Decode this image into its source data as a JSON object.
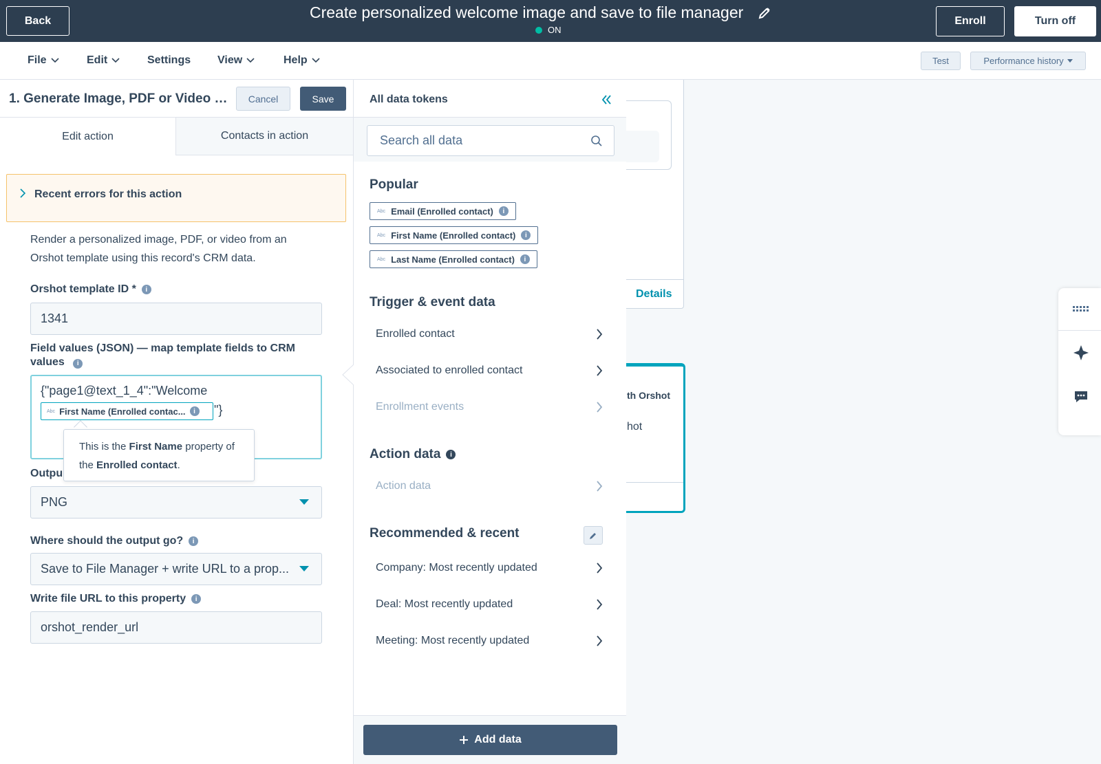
{
  "topbar": {
    "back_label": "Back",
    "title": "Create personalized welcome image and save to file manager",
    "status": "ON",
    "status_color": "#00bda5",
    "enroll_label": "Enroll",
    "turnoff_label": "Turn off"
  },
  "menubar": {
    "file": "File",
    "edit": "Edit",
    "settings": "Settings",
    "view": "View",
    "help": "Help",
    "test": "Test",
    "performance": "Performance history"
  },
  "panel": {
    "title": "1. Generate Image, PDF or Video wi...",
    "cancel": "Cancel",
    "save": "Save",
    "tab_edit": "Edit action",
    "tab_contacts": "Contacts in action",
    "errors": "Recent errors for this action",
    "description": "Render a personalized image, PDF, or video from an Orshot template using this record's CRM data.",
    "template_label": "Orshot template ID *",
    "template_value": "1341",
    "fields_label": "Field values (JSON) — map template fields to CRM values",
    "json_prefix": "{\"page1@text_1_4\":\"Welcome",
    "token_label": "First Name (Enrolled contac...",
    "json_suffix": "\"}",
    "tooltip_p1": "This is the ",
    "tooltip_b1": "First Name",
    "tooltip_p2": " property of the ",
    "tooltip_b2": "Enrolled contact",
    "tooltip_p3": ".",
    "output_label": "Outpu",
    "output_value": "PNG",
    "destination_label": "Where should the output go?",
    "destination_value": "Save to File Manager + write URL to a prop...",
    "url_label": "Write file URL to this property",
    "url_value": "orshot_render_url"
  },
  "tokens": {
    "title": "All data tokens",
    "search_placeholder": "Search all data",
    "popular_title": "Popular",
    "popular": [
      "Email (Enrolled contact)",
      "First Name (Enrolled contact)",
      "Last Name (Enrolled contact)"
    ],
    "abc": "Abc",
    "trigger_title": "Trigger & event data",
    "trigger_items": [
      "Enrolled contact",
      "Associated to enrolled contact",
      "Enrollment events"
    ],
    "action_title": "Action data",
    "action_items": [
      "Action data"
    ],
    "recommended_title": "Recommended & recent",
    "recommended_items": [
      "Company: Most recently updated",
      "Deal: Most recently updated",
      "Meeting: Most recently updated"
    ],
    "add_data": "Add data"
  },
  "canvas": {
    "details": "Details",
    "card2_title": "th Orshot",
    "card2_text": "hot"
  },
  "colors": {
    "topbar": "#2d3e50",
    "primary_button": "#425b76",
    "link": "#0091ae",
    "accent": "#00a4bd"
  }
}
